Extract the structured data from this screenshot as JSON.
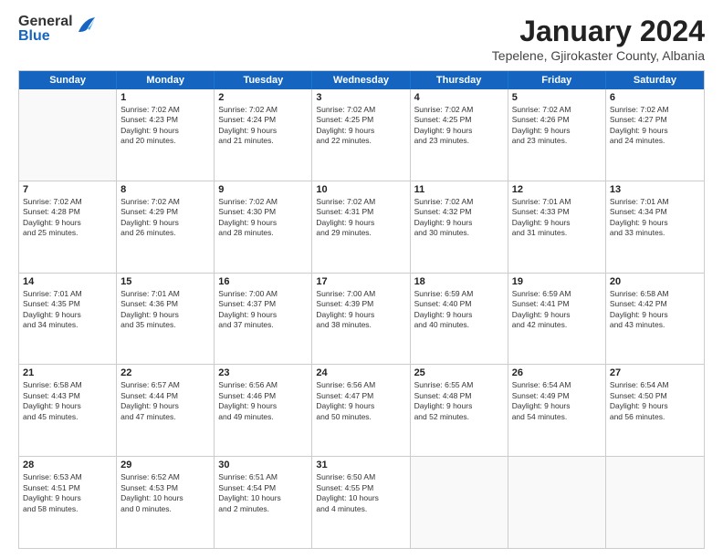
{
  "logo": {
    "general": "General",
    "blue": "Blue"
  },
  "title": "January 2024",
  "subtitle": "Tepelene, Gjirokaster County, Albania",
  "days_of_week": [
    "Sunday",
    "Monday",
    "Tuesday",
    "Wednesday",
    "Thursday",
    "Friday",
    "Saturday"
  ],
  "weeks": [
    [
      {
        "day": "",
        "info": ""
      },
      {
        "day": "1",
        "info": "Sunrise: 7:02 AM\nSunset: 4:23 PM\nDaylight: 9 hours\nand 20 minutes."
      },
      {
        "day": "2",
        "info": "Sunrise: 7:02 AM\nSunset: 4:24 PM\nDaylight: 9 hours\nand 21 minutes."
      },
      {
        "day": "3",
        "info": "Sunrise: 7:02 AM\nSunset: 4:25 PM\nDaylight: 9 hours\nand 22 minutes."
      },
      {
        "day": "4",
        "info": "Sunrise: 7:02 AM\nSunset: 4:25 PM\nDaylight: 9 hours\nand 23 minutes."
      },
      {
        "day": "5",
        "info": "Sunrise: 7:02 AM\nSunset: 4:26 PM\nDaylight: 9 hours\nand 23 minutes."
      },
      {
        "day": "6",
        "info": "Sunrise: 7:02 AM\nSunset: 4:27 PM\nDaylight: 9 hours\nand 24 minutes."
      }
    ],
    [
      {
        "day": "7",
        "info": ""
      },
      {
        "day": "8",
        "info": "Sunrise: 7:02 AM\nSunset: 4:29 PM\nDaylight: 9 hours\nand 26 minutes."
      },
      {
        "day": "9",
        "info": "Sunrise: 7:02 AM\nSunset: 4:30 PM\nDaylight: 9 hours\nand 28 minutes."
      },
      {
        "day": "10",
        "info": "Sunrise: 7:02 AM\nSunset: 4:31 PM\nDaylight: 9 hours\nand 29 minutes."
      },
      {
        "day": "11",
        "info": "Sunrise: 7:02 AM\nSunset: 4:32 PM\nDaylight: 9 hours\nand 30 minutes."
      },
      {
        "day": "12",
        "info": "Sunrise: 7:01 AM\nSunset: 4:33 PM\nDaylight: 9 hours\nand 31 minutes."
      },
      {
        "day": "13",
        "info": "Sunrise: 7:01 AM\nSunset: 4:34 PM\nDaylight: 9 hours\nand 33 minutes."
      }
    ],
    [
      {
        "day": "14",
        "info": ""
      },
      {
        "day": "15",
        "info": "Sunrise: 7:01 AM\nSunset: 4:36 PM\nDaylight: 9 hours\nand 35 minutes."
      },
      {
        "day": "16",
        "info": "Sunrise: 7:00 AM\nSunset: 4:37 PM\nDaylight: 9 hours\nand 37 minutes."
      },
      {
        "day": "17",
        "info": "Sunrise: 7:00 AM\nSunset: 4:39 PM\nDaylight: 9 hours\nand 38 minutes."
      },
      {
        "day": "18",
        "info": "Sunrise: 6:59 AM\nSunset: 4:40 PM\nDaylight: 9 hours\nand 40 minutes."
      },
      {
        "day": "19",
        "info": "Sunrise: 6:59 AM\nSunset: 4:41 PM\nDaylight: 9 hours\nand 42 minutes."
      },
      {
        "day": "20",
        "info": "Sunrise: 6:58 AM\nSunset: 4:42 PM\nDaylight: 9 hours\nand 43 minutes."
      }
    ],
    [
      {
        "day": "21",
        "info": ""
      },
      {
        "day": "22",
        "info": "Sunrise: 6:57 AM\nSunset: 4:44 PM\nDaylight: 9 hours\nand 47 minutes."
      },
      {
        "day": "23",
        "info": "Sunrise: 6:56 AM\nSunset: 4:46 PM\nDaylight: 9 hours\nand 49 minutes."
      },
      {
        "day": "24",
        "info": "Sunrise: 6:56 AM\nSunset: 4:47 PM\nDaylight: 9 hours\nand 50 minutes."
      },
      {
        "day": "25",
        "info": "Sunrise: 6:55 AM\nSunset: 4:48 PM\nDaylight: 9 hours\nand 52 minutes."
      },
      {
        "day": "26",
        "info": "Sunrise: 6:54 AM\nSunset: 4:49 PM\nDaylight: 9 hours\nand 54 minutes."
      },
      {
        "day": "27",
        "info": "Sunrise: 6:54 AM\nSunset: 4:50 PM\nDaylight: 9 hours\nand 56 minutes."
      }
    ],
    [
      {
        "day": "28",
        "info": "Sunrise: 6:53 AM\nSunset: 4:51 PM\nDaylight: 9 hours\nand 58 minutes."
      },
      {
        "day": "29",
        "info": "Sunrise: 6:52 AM\nSunset: 4:53 PM\nDaylight: 10 hours\nand 0 minutes."
      },
      {
        "day": "30",
        "info": "Sunrise: 6:51 AM\nSunset: 4:54 PM\nDaylight: 10 hours\nand 2 minutes."
      },
      {
        "day": "31",
        "info": "Sunrise: 6:50 AM\nSunset: 4:55 PM\nDaylight: 10 hours\nand 4 minutes."
      },
      {
        "day": "",
        "info": ""
      },
      {
        "day": "",
        "info": ""
      },
      {
        "day": "",
        "info": ""
      }
    ]
  ],
  "week7_sunday": {
    "info": "Sunrise: 7:02 AM\nSunset: 4:28 PM\nDaylight: 9 hours\nand 25 minutes."
  },
  "week14_sunday": {
    "info": "Sunrise: 7:01 AM\nSunset: 4:35 PM\nDaylight: 9 hours\nand 34 minutes."
  },
  "week21_sunday": {
    "info": "Sunrise: 6:58 AM\nSunset: 4:43 PM\nDaylight: 9 hours\nand 45 minutes."
  }
}
